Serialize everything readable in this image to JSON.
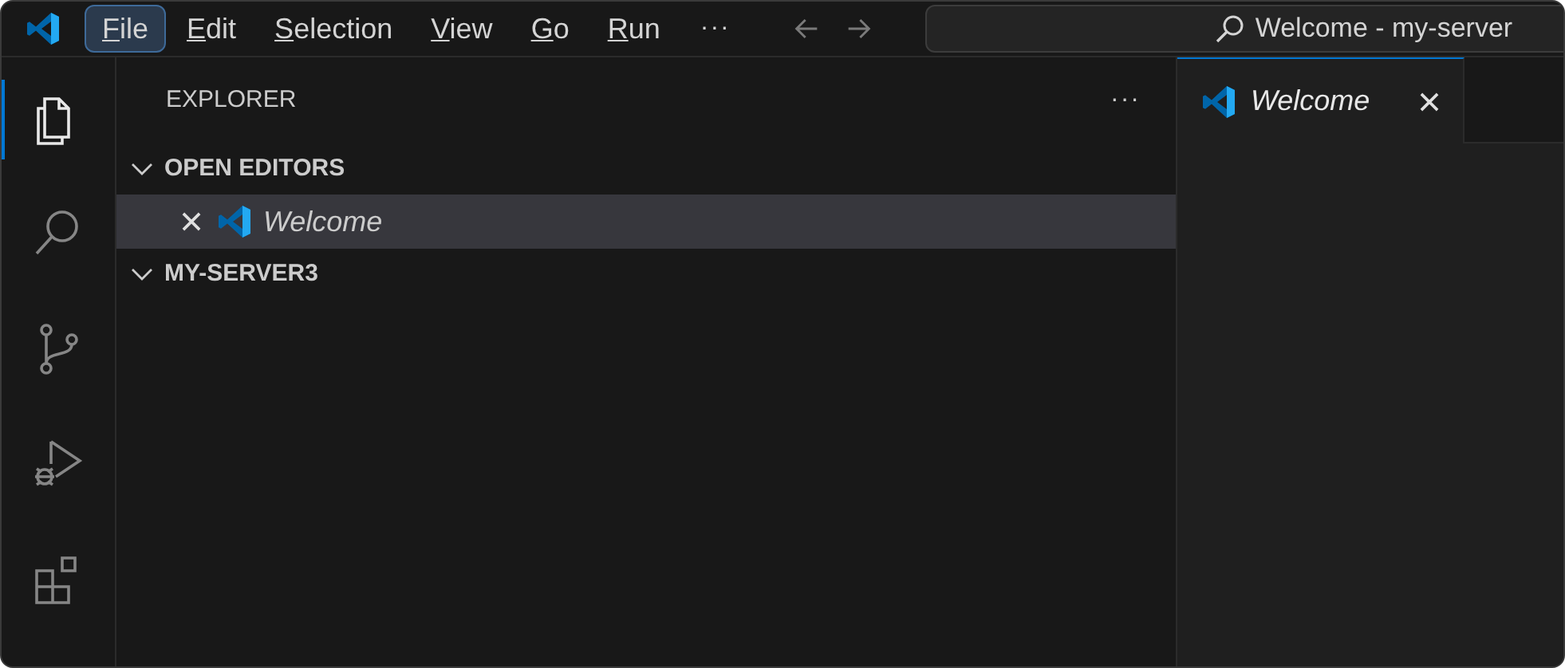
{
  "title_bar": {
    "menu": [
      {
        "label": "File",
        "selected": true
      },
      {
        "label": "Edit",
        "selected": false
      },
      {
        "label": "Selection",
        "selected": false
      },
      {
        "label": "View",
        "selected": false
      },
      {
        "label": "Go",
        "selected": false
      },
      {
        "label": "Run",
        "selected": false
      }
    ],
    "more": "···",
    "search": {
      "text": "Welcome - my-server"
    }
  },
  "activity_bar": [
    {
      "kind": "files",
      "selected": true
    },
    {
      "kind": "search",
      "selected": false
    },
    {
      "kind": "source-control",
      "selected": false
    },
    {
      "kind": "run-debug",
      "selected": false
    },
    {
      "kind": "extensions",
      "selected": false
    }
  ],
  "sidebar": {
    "title": "EXPLORER",
    "more": "···",
    "sections": [
      {
        "title": "OPEN EDITORS",
        "expanded": true,
        "items": [
          {
            "label": "Welcome",
            "selected": true
          }
        ]
      },
      {
        "title": "MY-SERVER3",
        "expanded": true
      }
    ]
  },
  "editor": {
    "tabs": [
      {
        "label": "Welcome",
        "selected": true
      }
    ]
  }
}
